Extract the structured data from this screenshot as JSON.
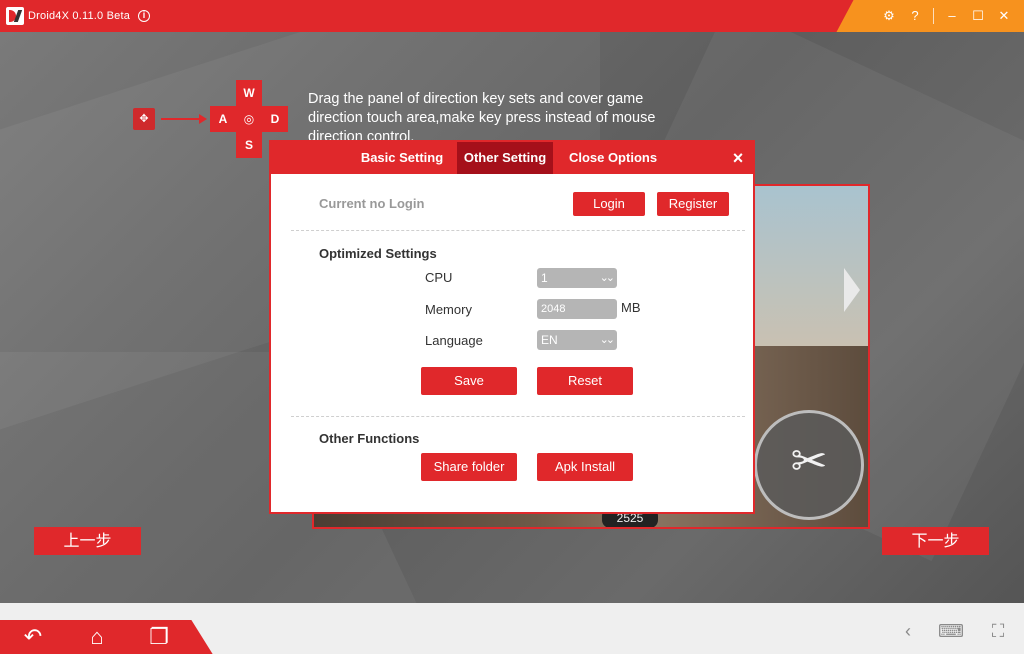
{
  "titlebar": {
    "app_title": "Droid4X 0.11.0 Beta",
    "icons": [
      "settings-icon",
      "help-icon",
      "minimize-icon",
      "maximize-icon",
      "close-icon"
    ]
  },
  "instruction": {
    "keys": {
      "up": "W",
      "left": "A",
      "center": "◎",
      "right": "D",
      "down": "S"
    },
    "text": "Drag the panel of direction key sets and cover game direction touch area,make key press instead of mouse direction control."
  },
  "preview": {
    "counter": "2525"
  },
  "dialog": {
    "tabs": [
      {
        "label": "Basic Setting",
        "active": false
      },
      {
        "label": "Other Setting",
        "active": true
      },
      {
        "label": "Close Options",
        "active": false
      }
    ],
    "login_status": "Current no Login",
    "login_label": "Login",
    "register_label": "Register",
    "optimized_title": "Optimized Settings",
    "cpu_label": "CPU",
    "cpu_value": "1",
    "memory_label": "Memory",
    "memory_value": "2048",
    "memory_unit": "MB",
    "language_label": "Language",
    "language_value": "EN",
    "save_label": "Save",
    "reset_label": "Reset",
    "other_title": "Other Functions",
    "share_folder_label": "Share folder",
    "apk_install_label": "Apk Install"
  },
  "steps": {
    "prev": "上一步",
    "next": "下一步"
  },
  "colors": {
    "brand_red": "#e0282b",
    "active_tab": "#a5101a",
    "title_orange": "#f7921e"
  }
}
